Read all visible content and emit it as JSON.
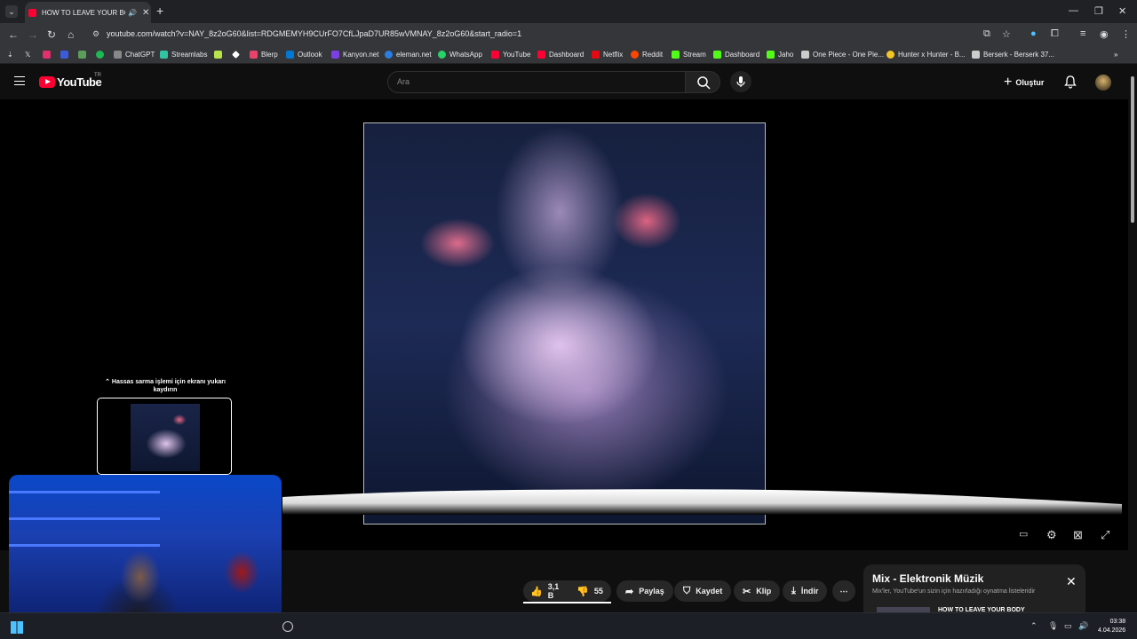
{
  "browser": {
    "tab_title": "HOW TO LEAVE YOUR BODY",
    "url": "youtube.com/watch?v=NAY_8z2oG60&list=RDGMEMYH9CUrFO7CfLJpaD7UR85wVMNAY_8z2oG60&start_radio=1",
    "bookmarks": [
      {
        "label": "ChatGPT",
        "color": "#888888"
      },
      {
        "label": "Streamlabs",
        "color": "#31c3a2"
      },
      {
        "label": "Blerp",
        "color": "#e8436b"
      },
      {
        "label": "Outlook",
        "color": "#0078d4"
      },
      {
        "label": "Kanyon.net",
        "color": "#7b3fe4"
      },
      {
        "label": "eleman.net",
        "color": "#2a7de1"
      },
      {
        "label": "WhatsApp",
        "color": "#25d366"
      },
      {
        "label": "YouTube",
        "color": "#ff0033"
      },
      {
        "label": "Dashboard",
        "color": "#ff0033"
      },
      {
        "label": "Netflix",
        "color": "#e50914"
      },
      {
        "label": "Reddit",
        "color": "#ff4500"
      },
      {
        "label": "Stream",
        "color": "#53fc18"
      },
      {
        "label": "Dashboard",
        "color": "#53fc18"
      },
      {
        "label": "Jaho",
        "color": "#53fc18"
      },
      {
        "label": "One Piece - One Pie...",
        "color": "#cccccc"
      },
      {
        "label": "Hunter x Hunter - B...",
        "color": "#f3c623"
      },
      {
        "label": "Berserk - Berserk 37...",
        "color": "#cccccc"
      }
    ]
  },
  "youtube": {
    "logo_text": "YouTube",
    "country": "TR",
    "search_placeholder": "Ara",
    "create_label": "Oluştur"
  },
  "player": {
    "hint_text": "Hassas sarma işlemi için ekranı yukarı kaydırın"
  },
  "actions": {
    "like_count": "3,1 B",
    "dislike_count": "55",
    "share": "Paylaş",
    "save": "Kaydet",
    "clip": "Klip",
    "download": "İndir"
  },
  "mix": {
    "title": "Mix - Elektronik Müzik",
    "subtitle": "Mix'ler, YouTube'un sizin için hazırladığı oynatma listeleridir",
    "first_item": "HOW TO LEAVE YOUR BODY"
  },
  "taskbar": {
    "time": "03:38",
    "date": "4.04.2026"
  }
}
